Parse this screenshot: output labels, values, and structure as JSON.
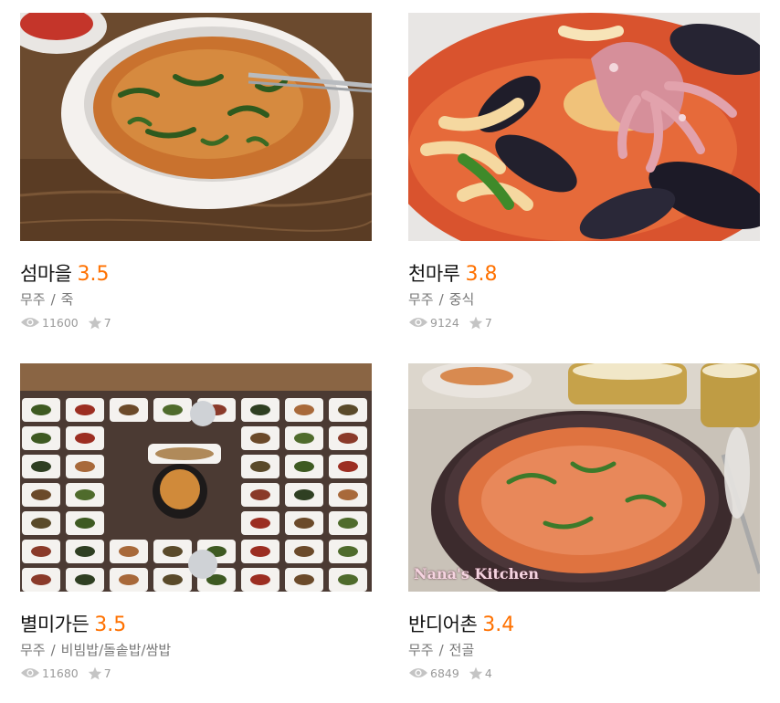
{
  "restaurants": [
    {
      "name": "섬마을",
      "rating": "3.5",
      "region": "무주",
      "separator": "/",
      "category": "죽",
      "views": "11600",
      "favorites": "7",
      "photo": "porridge-bowl"
    },
    {
      "name": "천마루",
      "rating": "3.8",
      "region": "무주",
      "separator": "/",
      "category": "중식",
      "views": "9124",
      "favorites": "7",
      "photo": "seafood-jjamppong"
    },
    {
      "name": "별미가든",
      "rating": "3.5",
      "region": "무주",
      "separator": "/",
      "category": "비빔밥/돌솥밥/쌈밥",
      "views": "11680",
      "favorites": "7",
      "photo": "side-dish-table"
    },
    {
      "name": "반디어촌",
      "rating": "3.4",
      "region": "무주",
      "separator": "/",
      "category": "전골",
      "views": "6849",
      "favorites": "4",
      "photo": "fish-stew-pot",
      "watermark": "Nana's Kitchen"
    }
  ],
  "icons": {
    "views": "eye-icon",
    "favorites": "star-icon"
  },
  "colors": {
    "rating": "#ff7100",
    "meta": "#777777",
    "stats": "#9a9a9a"
  }
}
